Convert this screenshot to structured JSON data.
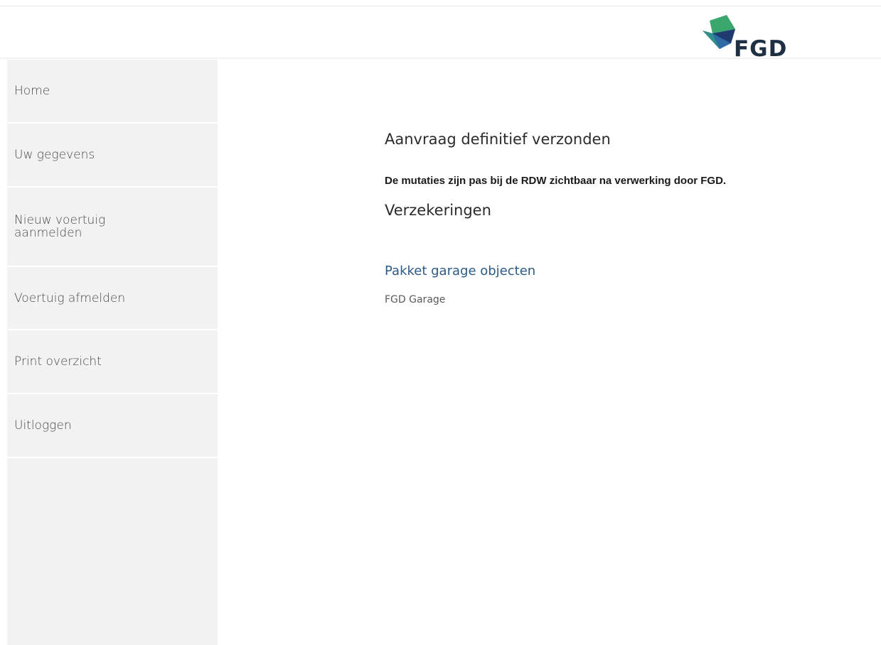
{
  "brand": {
    "logo_text": "FGD",
    "colors": {
      "green": "#3aa76d",
      "dark_blue": "#1f3a6e",
      "mid_blue": "#2e6aa3",
      "teal": "#2f8f8a",
      "text": "#1f2f44"
    }
  },
  "sidebar": {
    "items": [
      {
        "label": "Home"
      },
      {
        "label": "Uw gegevens"
      },
      {
        "label": "Nieuw voertuig aanmelden"
      },
      {
        "label": "Voertuig afmelden"
      },
      {
        "label": "Print overzicht"
      },
      {
        "label": "Uitloggen"
      }
    ]
  },
  "main": {
    "title": "Aanvraag definitief verzonden",
    "notice": "De mutaties zijn pas bij de RDW zichtbaar na verwerking door FGD.",
    "section_title": "Verzekeringen",
    "package": {
      "link_label": "Pakket garage objecten",
      "subtitle": "FGD Garage"
    }
  }
}
